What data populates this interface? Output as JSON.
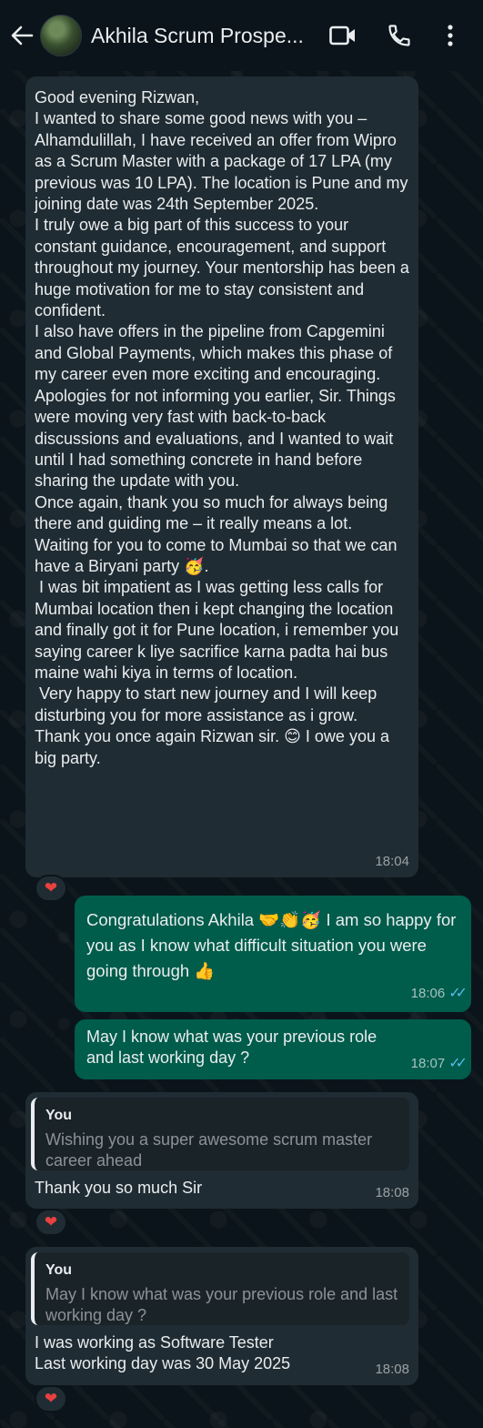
{
  "header": {
    "contact_name": "Akhila Scrum Prospe..."
  },
  "messages": [
    {
      "text": "Good evening Rizwan,\nI wanted to share some good news with you – Alhamdulillah, I have received an offer from Wipro as a Scrum Master with a package of 17 LPA (my previous was 10 LPA). The location is Pune and my joining date was 24th September 2025.\nI truly owe a big part of this success to your constant guidance, encouragement, and support throughout my journey. Your mentorship has been a huge motivation for me to stay consistent and confident.\nI also have offers in the pipeline from Capgemini and Global Payments, which makes this phase of my career even more exciting and encouraging.\nApologies for not informing you earlier, Sir. Things were moving very fast with back-to-back discussions and evaluations, and I wanted to wait until I had something concrete in hand before sharing the update with you.\nOnce again, thank you so much for always being there and guiding me – it really means a lot.\nWaiting for you to come to Mumbai so that we can have a Biryani party 🥳.\n I was bit impatient as I was getting less calls for Mumbai location then i kept changing the location and finally got it for Pune location, i remember you saying career k liye sacrifice karna padta hai bus maine wahi kiya in terms of location.\n Very happy to start new journey and I will keep disturbing you for more assistance as i grow.\nThank you once again Rizwan sir. 😊 I owe you a big party.",
      "time": "18:04",
      "reaction": "❤"
    },
    {
      "text": "Congratulations Akhila 🤝👏🥳 I am so happy for you as I know what difficult situation you were going through 👍",
      "time": "18:06",
      "ticks": "✓✓"
    },
    {
      "text": "May I know what was your previous role and last working day ?",
      "time": "18:07",
      "ticks": "✓✓"
    },
    {
      "quote_author": "You",
      "quote_text": "Wishing you a super awesome scrum master career ahead",
      "text": "Thank you so much Sir",
      "time": "18:08",
      "reaction": "❤"
    },
    {
      "quote_author": "You",
      "quote_text": "May I know what was your previous role and last working day ?",
      "text": "I was working as Software Tester\nLast working day was 30 May 2025",
      "time": "18:08",
      "reaction": "❤"
    }
  ],
  "colors": {
    "background": "#0b141a",
    "incoming_bubble": "#202c33",
    "outgoing_bubble": "#005c4b",
    "read_ticks": "#53bdeb",
    "reaction_heart": "#e8413f"
  }
}
